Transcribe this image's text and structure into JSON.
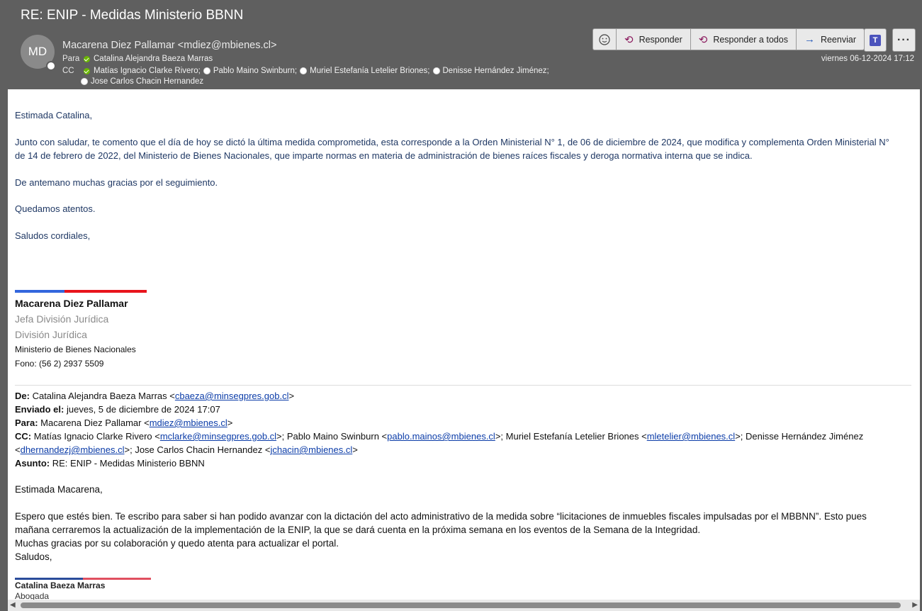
{
  "window": {
    "subject": "RE: ENIP - Medidas Ministerio BBNN"
  },
  "message": {
    "avatar_initials": "MD",
    "from": "Macarena Diez Pallamar <mdiez@mbienes.cl>",
    "to_label": "Para",
    "to": "Catalina Alejandra Baeza Marras",
    "cc_label": "CC",
    "cc": [
      "Matías Ignacio Clarke Rivero;",
      "Pablo Maino Swinburn;",
      "Muriel Estefanía Letelier Briones;",
      "Denisse Hernández Jiménez;",
      "Jose Carlos Chacin Hernandez"
    ],
    "date": "viernes 06-12-2024 17:12"
  },
  "toolbar": {
    "emoji_icon": "emoji-icon",
    "reply": "Responder",
    "reply_all": "Responder a todos",
    "forward": "Reenviar",
    "more": "···"
  },
  "body": {
    "greeting": "Estimada Catalina,",
    "para1_line1": "Junto con saludar, te comento que el día de hoy se dictó la última medida comprometida, esta corresponde a la Orden Ministerial N° 1, de 06 de diciembre de 2024, que modifica y complementa Orden Ministerial N°",
    "para1_line2": "de 14 de febrero de 2022, del Ministerio de Bienes Nacionales, que imparte normas en materia de administración de bienes raíces fiscales y deroga normativa interna que se indica.",
    "para2": "De antemano muchas gracias por el seguimiento.",
    "para3": "Quedamos atentos.",
    "closing": "Saludos cordiales,",
    "signature": {
      "name": "Macarena Diez Pallamar",
      "role1": "Jefa División Jurídica",
      "role2": "División Jurídica",
      "org": "Ministerio de Bienes Nacionales",
      "phone": "Fono: (56 2) 2937 5509"
    },
    "quoted": {
      "from_label": "De:",
      "from_name": "Catalina Alejandra Baeza Marras <",
      "from_email": "cbaeza@minsegpres.gob.cl",
      "sent_label": "Enviado el:",
      "sent": "jueves, 5 de diciembre de 2024 17:07",
      "to_label": "Para:",
      "to_name": "Macarena Diez Pallamar <",
      "to_email": "mdiez@mbienes.cl",
      "cc_label": "CC:",
      "cc1_name": "Matías Ignacio Clarke Rivero <",
      "cc1_email": "mclarke@minsegpres.gob.cl",
      "cc2_name": ">; Pablo Maino Swinburn <",
      "cc2_email": "pablo.mainos@mbienes.cl",
      "cc3_name": ">; Muriel Estefanía Letelier Briones <",
      "cc3_email": "mletelier@mbienes.cl",
      "cc4_name": ">; Denisse Hernández Jiménez",
      "cc4_email": "dhernandezj@mbienes.cl",
      "cc5_name": ">; Jose Carlos Chacin Hernandez <",
      "cc5_email": "jchacin@mbienes.cl",
      "subject_label": "Asunto:",
      "subject": "RE: ENIP - Medidas Ministerio BBNN",
      "greeting": "Estimada Macarena,",
      "line1": "Espero que estés bien. Te escribo para saber si han podido avanzar con la dictación del acto administrativo de la medida sobre “licitaciones de inmuebles fiscales impulsadas por el MBBNN”. Esto pues",
      "line2": "mañana cerraremos la actualización de la implementación de la ENIP, la que se dará cuenta en la próxima semana en los eventos de la Semana de la Integridad.",
      "line3": "Muchas gracias por su colaboración y quedo atenta para actualizar el portal.",
      "line4": "Saludos,",
      "sig_name": "Catalina Baeza Marras",
      "sig_role": "Abogada"
    }
  }
}
